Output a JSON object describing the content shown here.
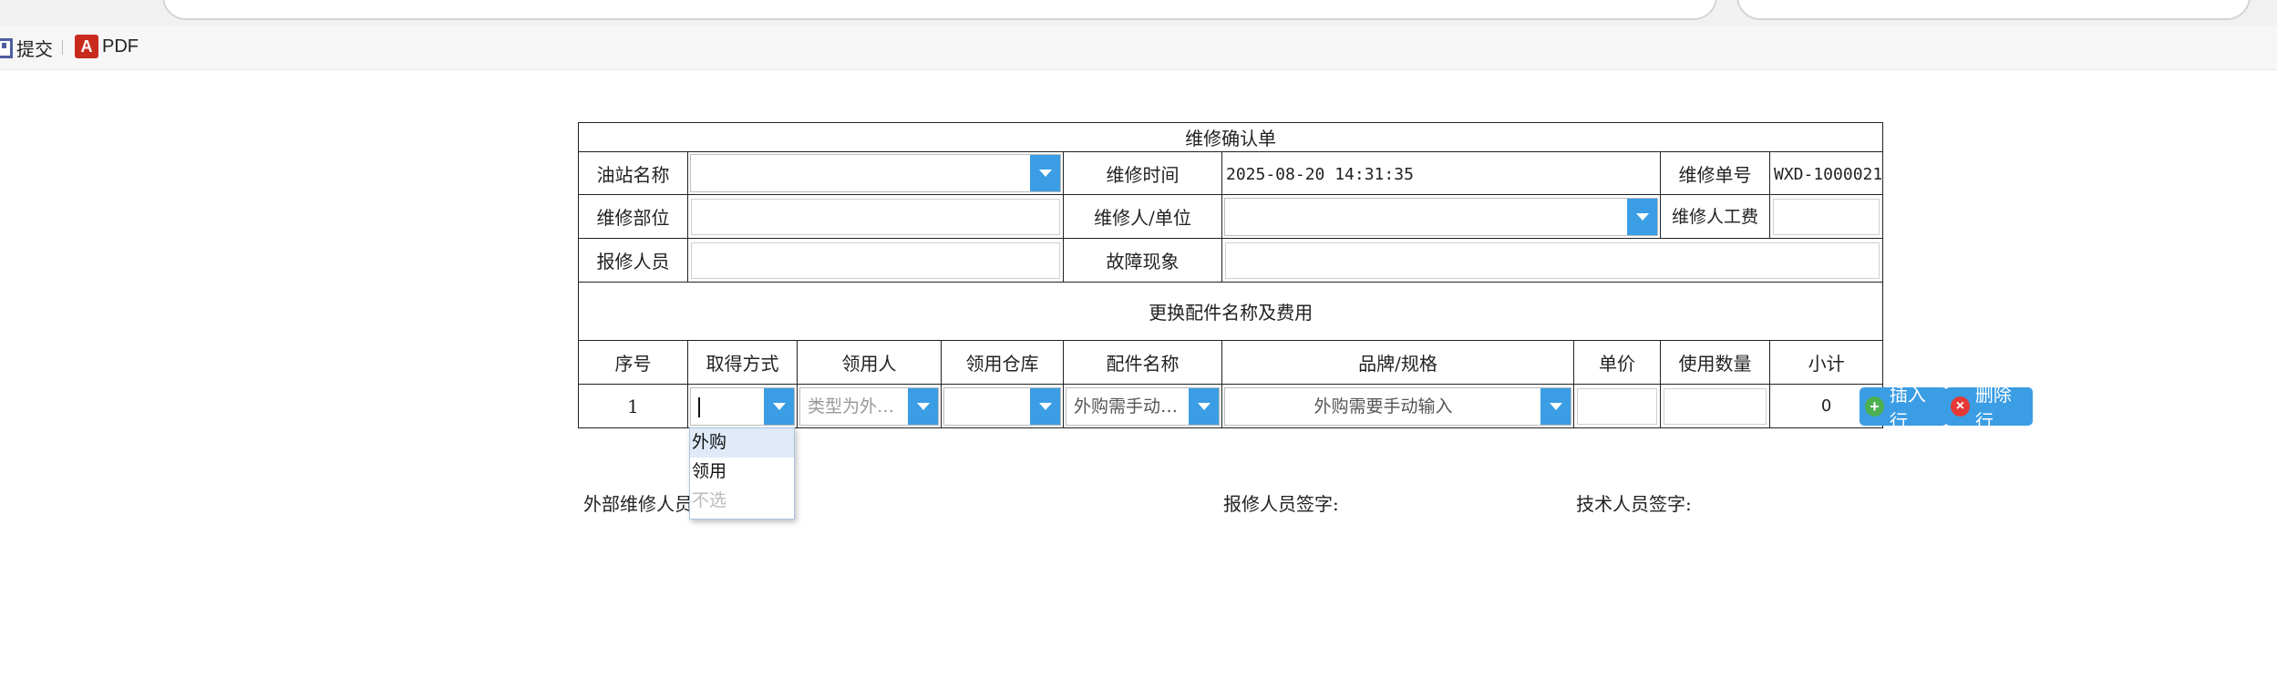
{
  "toolbar": {
    "submit_label": "提交",
    "pdf_label": "PDF",
    "pdf_icon_text": "A"
  },
  "form": {
    "title": "维修确认单",
    "station_label": "油站名称",
    "station_value": "",
    "repair_time_label": "维修时间",
    "repair_time_value": "2025-08-20 14:31:35",
    "order_no_label": "维修单号",
    "order_no_value": "WXD-1000021",
    "repair_part_label": "维修部位",
    "repair_part_value": "",
    "repairer_label": "维修人/单位",
    "repairer_value": "",
    "labor_fee_label": "维修人工费",
    "labor_fee_value": "",
    "reporter_label": "报修人员",
    "reporter_value": "",
    "fault_label": "故障现象",
    "fault_value": "",
    "parts_section_title": "更换配件名称及费用"
  },
  "parts_table": {
    "headers": [
      "序号",
      "取得方式",
      "领用人",
      "领用仓库",
      "配件名称",
      "品牌/规格",
      "单价",
      "使用数量",
      "小计"
    ],
    "row": {
      "index": "1",
      "acquire_method": "",
      "receiver_placeholder": "类型为外…",
      "warehouse": "",
      "part_name_placeholder": "外购需手动…",
      "brand_placeholder": "外购需要手动输入",
      "unit_price": "",
      "quantity": "",
      "subtotal": "0"
    }
  },
  "dropdown": {
    "options": [
      "外购",
      "领用",
      "不选"
    ],
    "selected": "外购"
  },
  "buttons": {
    "insert_row": "插入行",
    "delete_row": "删除行"
  },
  "signatures": {
    "external": "外部维修人员",
    "reporter": "报修人员签字:",
    "tech": "技术人员签字:"
  },
  "colors": {
    "accent": "#3b9de4",
    "insert_icon": "#4caf50",
    "delete_icon": "#e53935"
  }
}
